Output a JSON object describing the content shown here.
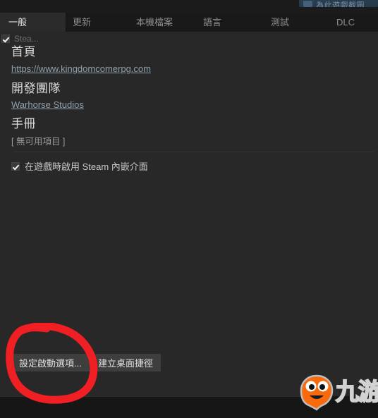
{
  "window": {
    "top_button": {
      "label": "為此遊戲截圖",
      "icon": "camera-icon"
    }
  },
  "tabs": [
    {
      "label": "一般",
      "name": "tab-general",
      "selected": true
    },
    {
      "label": "更新",
      "name": "tab-updates",
      "selected": false
    },
    {
      "label": "本機檔案",
      "name": "tab-local-files",
      "selected": false
    },
    {
      "label": "語言",
      "name": "tab-language",
      "selected": false
    },
    {
      "label": "測試",
      "name": "tab-betas",
      "selected": false
    },
    {
      "label": "DLC",
      "name": "tab-dlc",
      "selected": false
    }
  ],
  "general": {
    "steam_cloud": {
      "label": "Stea...",
      "checked": true
    },
    "home": {
      "heading": "首頁",
      "link": "https://www.kingdomcomerpg.com"
    },
    "developer": {
      "heading": "開發團隊",
      "link": "Warhorse Studios"
    },
    "manual": {
      "heading": "手冊",
      "note": "[ 無可用項目 ]"
    },
    "overlay": {
      "label": "在遊戲時啟用 Steam 內嵌介面",
      "checked": true
    },
    "buttons": {
      "launch_options": "設定啟動選項...",
      "desktop_shortcut": "建立桌面捷徑"
    }
  },
  "annotation": {
    "shape": "hand-drawn-ellipse",
    "color": "#ef1f24",
    "target": "設定啟動選項..."
  },
  "watermark": {
    "text": "九游",
    "mascot_color": "#f96a0d"
  }
}
